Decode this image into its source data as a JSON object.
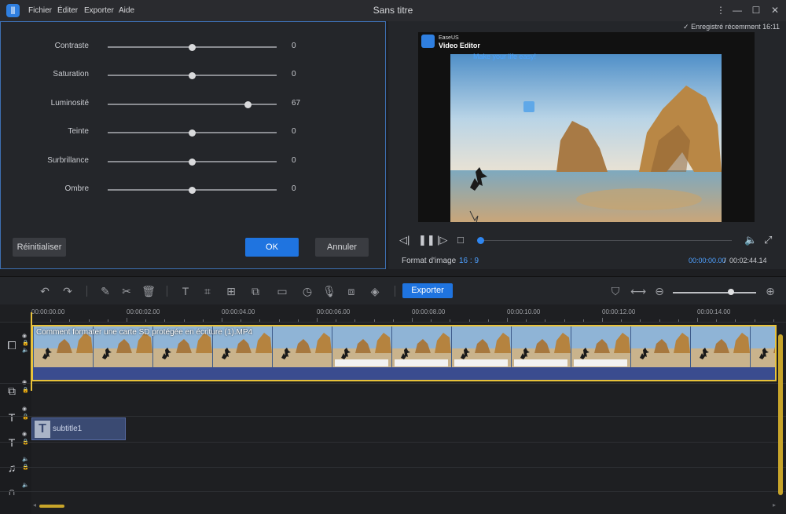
{
  "app": {
    "logo_letter": "||",
    "title": "Sans titre",
    "menu": [
      "Fichier",
      "Éditer",
      "Exporter",
      "Aide"
    ]
  },
  "adjust": {
    "sliders": [
      {
        "label": "Contraste",
        "value": "0",
        "fraction": 0.5
      },
      {
        "label": "Saturation",
        "value": "0",
        "fraction": 0.5
      },
      {
        "label": "Luminosité",
        "value": "67",
        "fraction": 0.83
      },
      {
        "label": "Teinte",
        "value": "0",
        "fraction": 0.5
      },
      {
        "label": "Surbrillance",
        "value": "0",
        "fraction": 0.5
      },
      {
        "label": "Ombre",
        "value": "0",
        "fraction": 0.5
      }
    ],
    "reset_label": "Réinitialiser",
    "ok_label": "OK",
    "cancel_label": "Annuler"
  },
  "preview": {
    "saved_label": "Enregistré récemment 16:11",
    "easeus_small": "EaseUS",
    "easeus_title": "Video Editor",
    "tagline": "Make your life easy!",
    "format_label": "Format d'image",
    "format_value": "16 : 9",
    "time_current": "00:00:00.00",
    "time_separator": "/",
    "time_total": "00:02:44.14",
    "progress": 0
  },
  "toolbar": {
    "export_label": "Exporter"
  },
  "timeline": {
    "ticks": [
      "00:00:00.00",
      "00:00:02.00",
      "00:00:04.00",
      "00:00:06.00",
      "00:00:08.00",
      "00:00:10.00",
      "00:00:12.00",
      "00:00:14.00"
    ],
    "video_clip_title": "Comment formater une carte SD protégée en écriture (1).MP4",
    "subtitle_clip_name": "subtitle1"
  },
  "colors": {
    "accent": "#1f74e0",
    "playhead": "#e8c23a",
    "time_blue": "#4ea0ff"
  }
}
